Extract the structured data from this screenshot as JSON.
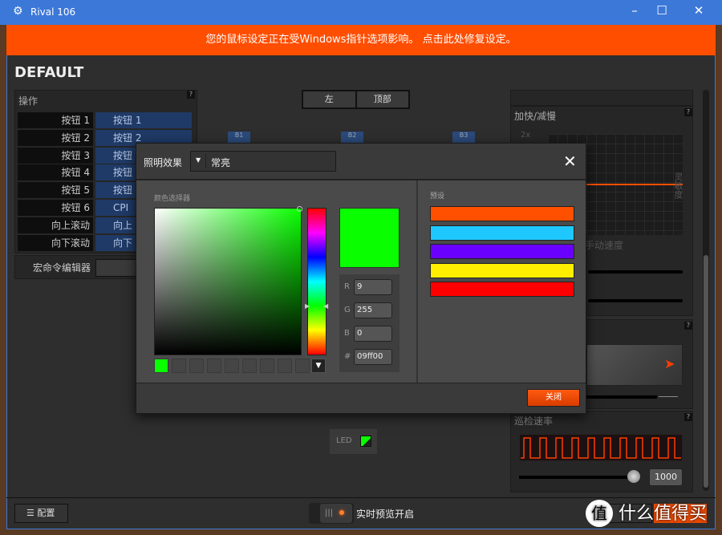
{
  "window": {
    "title": "Rival 106",
    "minimize": "–",
    "maximize": "☐",
    "close": "✕"
  },
  "banner": "您的鼠标设定正在受Windows指针选项影响。 点击此处修复设定。",
  "profile": "DEFAULT",
  "actions": {
    "title": "操作",
    "help": "?",
    "rows": [
      {
        "button": "按钮 1",
        "action": "按钮 1"
      },
      {
        "button": "按钮 2",
        "action": "按钮 2"
      },
      {
        "button": "按钮 3",
        "action": "按钮"
      },
      {
        "button": "按钮 4",
        "action": "按钮"
      },
      {
        "button": "按钮 5",
        "action": "按钮"
      },
      {
        "button": "按钮 6",
        "action": "CPI"
      },
      {
        "button": "向上滚动",
        "action": "向上"
      },
      {
        "button": "向下滚动",
        "action": "向下"
      }
    ],
    "macro_editor": "宏命令编辑器"
  },
  "view_tabs": [
    "左",
    "顶部"
  ],
  "button_markers": [
    "B1",
    "B2",
    "B3"
  ],
  "acceleration": {
    "title": "加快/减慢",
    "help": "?",
    "y_top": "2x",
    "side_label": "灵敏度",
    "bottom_label": "手动速度"
  },
  "polling": {
    "title": "巡检速率",
    "help": "?",
    "value": "1000",
    "slider_fraction": 0.95
  },
  "led": {
    "label": "LED",
    "color": "#09ff00"
  },
  "dialog": {
    "effect_label": "照明效果",
    "effect_value": "常亮",
    "close_icon": "close-icon",
    "picker_title": "颜色选择器",
    "presets_title": "预设",
    "r_label": "R",
    "r": "9",
    "g_label": "G",
    "g": "255",
    "b_label": "B",
    "b": "0",
    "hex_label": "#",
    "hex": "09ff00",
    "current_color": "#09ff00",
    "presets": [
      "#ff5000",
      "#1ec8ff",
      "#6a00ff",
      "#ffee00",
      "#ff0000"
    ],
    "close_button": "关闭"
  },
  "footer": {
    "config": "配置",
    "preview": "实时预览开启"
  },
  "watermark": "值 什么值得买"
}
